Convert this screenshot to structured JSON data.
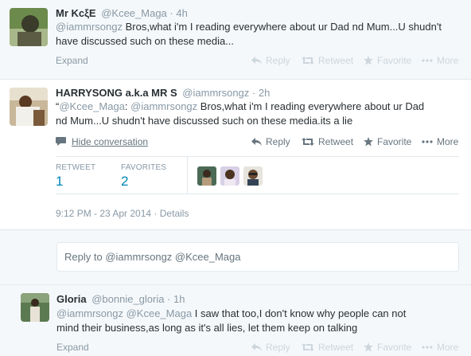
{
  "tweet1": {
    "name": "Mr KcξE",
    "handle": "@Kcee_Maga",
    "time": "4h",
    "text_mention": "@iammrsongz",
    "text": " Bros,what i'm I reading everywhere about ur Dad nd Mum...U shudn't have discussed such on these media...",
    "expand": "Expand",
    "reply": "Reply",
    "retweet": "Retweet",
    "favorite": "Favorite",
    "more": "More"
  },
  "tweet2": {
    "name": "HARRYSONG a.k.a MR S",
    "handle": "@iammrsongz",
    "time": "2h",
    "text_line1_pre": "“",
    "text_mention1": "@Kcee_Maga",
    "text_colon": ": ",
    "text_mention2": "@iammrsongz",
    "text_line1_rest": " Bros,what i'm I reading everywhere about ur Dad",
    "text_line2": "nd Mum...U shudn't have discussed such on these media.its a lie",
    "hide_conversation": "Hide conversation",
    "reply": "Reply",
    "retweet": "Retweet",
    "favorite": "Favorite",
    "more": "More",
    "stats": {
      "retweet_label": "RETWEET",
      "retweet_count": "1",
      "favorites_label": "FAVORITES",
      "favorites_count": "2"
    },
    "timestamp": "9:12 PM - 23 Apr 2014",
    "details": "Details"
  },
  "reply_box": {
    "placeholder_prefix": "Reply to ",
    "placeholder_handles": "@iammrsongz @Kcee_Maga"
  },
  "tweet3": {
    "name": "Gloria",
    "handle": "@bonnie_gloria",
    "time": "1h",
    "text_mentions": "@iammrsongz @Kcee_Maga",
    "text_line1_rest": " I saw that too,I don't know why people can not",
    "text_line2": "mind their business,as long as it's all lies, let them keep on talking",
    "expand": "Expand",
    "reply": "Reply",
    "retweet": "Retweet",
    "favorite": "Favorite",
    "more": "More"
  },
  "colors": {
    "link": "#0084b4",
    "muted": "#8899a6",
    "faded": "#ccd6dd",
    "border": "#e1e8ed",
    "bg_grey": "#f5f8fa"
  }
}
